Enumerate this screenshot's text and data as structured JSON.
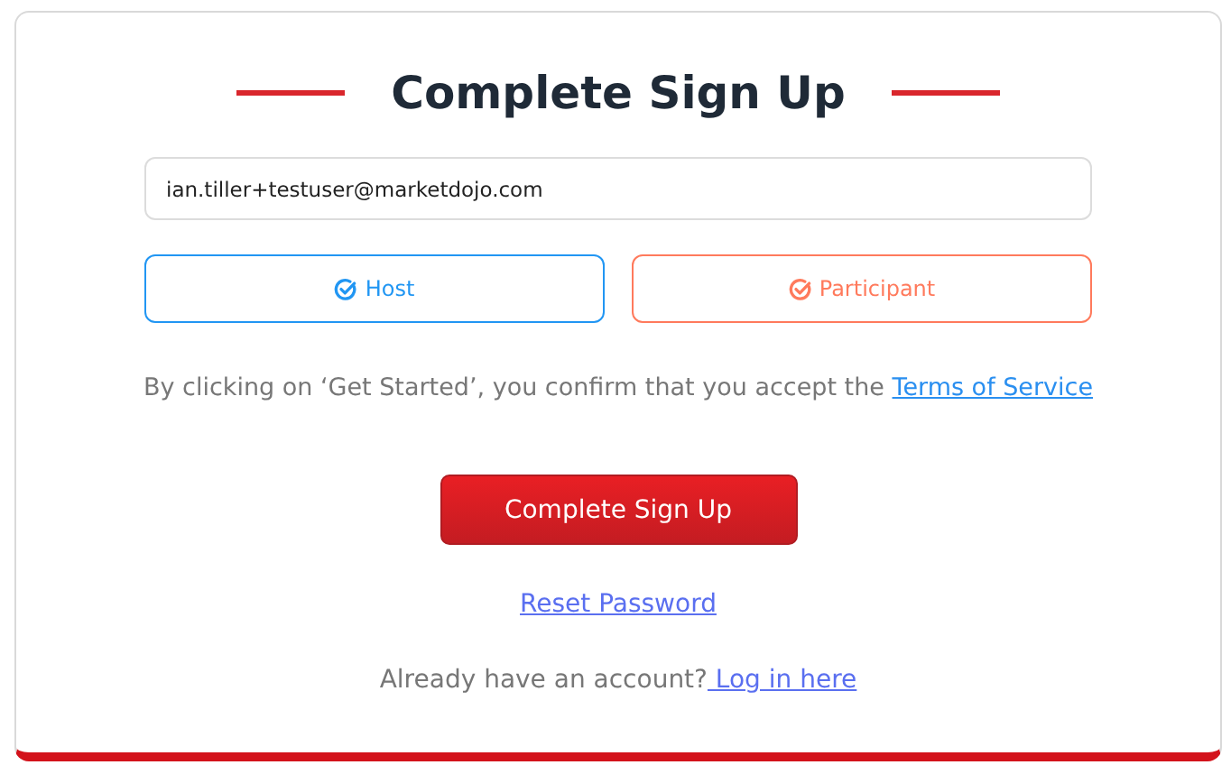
{
  "title": "Complete Sign Up",
  "email_field": {
    "value": "ian.tiller+testuser@marketdojo.com"
  },
  "roles": [
    {
      "label": "Host",
      "color": "#2196f3"
    },
    {
      "label": "Participant",
      "color": "#ff7a5c"
    }
  ],
  "consent": {
    "text": "By clicking on ‘Get Started’, you confirm that you accept the ",
    "link": "Terms of Service"
  },
  "submit_button": "Complete Sign Up",
  "reset_link": "Reset Password",
  "login": {
    "text": "Already have an account?",
    "link": " Log in here"
  }
}
